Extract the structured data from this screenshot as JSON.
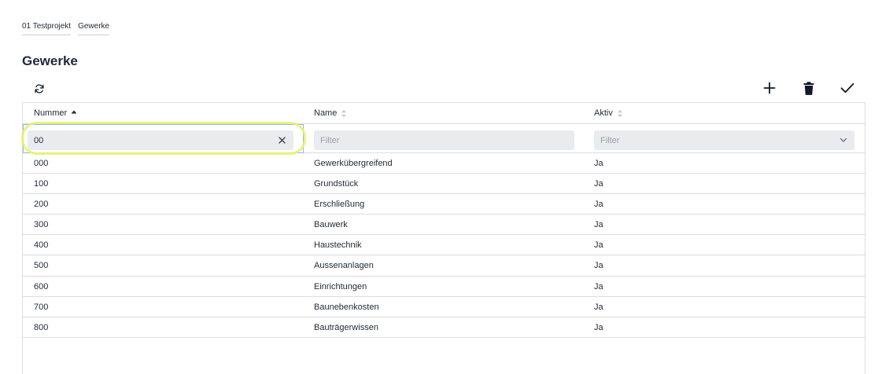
{
  "breadcrumb": [
    "01 Testprojekt",
    "Gewerke"
  ],
  "page_title": "Gewerke",
  "toolbar": {
    "refresh_icon": "refresh-icon",
    "add_icon": "plus-icon",
    "delete_icon": "trash-icon",
    "confirm_icon": "check-icon"
  },
  "columns": {
    "nummer": "Nummer",
    "name": "Name",
    "aktiv": "Aktiv"
  },
  "filters": {
    "nummer_value": "00",
    "name_placeholder": "Filter",
    "aktiv_placeholder": "Filter"
  },
  "rows": [
    {
      "nummer": "000",
      "name": "Gewerkübergreifend",
      "aktiv": "Ja"
    },
    {
      "nummer": "100",
      "name": "Grundstück",
      "aktiv": "Ja"
    },
    {
      "nummer": "200",
      "name": "Erschließung",
      "aktiv": "Ja"
    },
    {
      "nummer": "300",
      "name": "Bauwerk",
      "aktiv": "Ja"
    },
    {
      "nummer": "400",
      "name": "Haustechnik",
      "aktiv": "Ja"
    },
    {
      "nummer": "500",
      "name": "Aussenanlagen",
      "aktiv": "Ja"
    },
    {
      "nummer": "600",
      "name": "Einrichtungen",
      "aktiv": "Ja"
    },
    {
      "nummer": "700",
      "name": "Baunebenkosten",
      "aktiv": "Ja"
    },
    {
      "nummer": "800",
      "name": "Bauträgerwissen",
      "aktiv": "Ja"
    }
  ],
  "colors": {
    "text": "#1f2937",
    "border": "#dadde2",
    "filter_bg": "#e9ecef",
    "highlight": "#e6f36a"
  }
}
